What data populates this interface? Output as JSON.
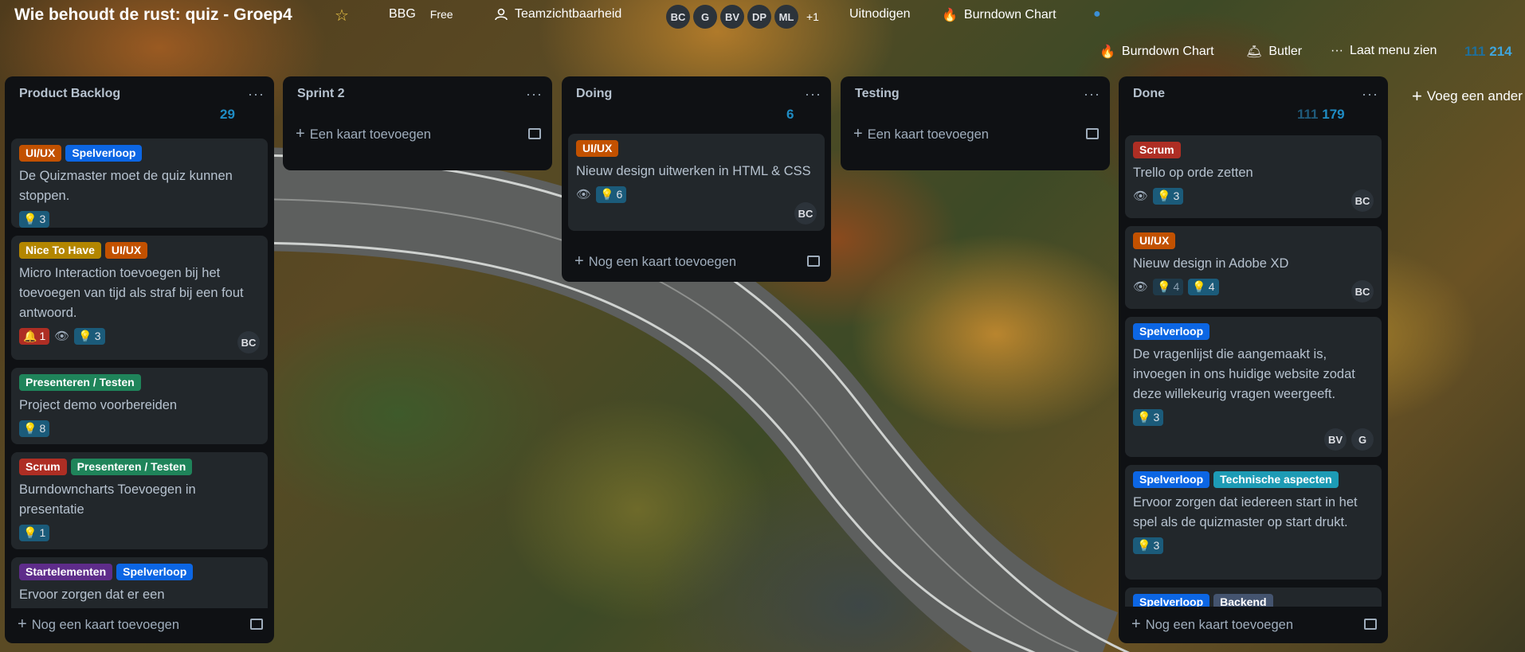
{
  "header": {
    "board_title": "Wie behoudt de rust: quiz - Groep4",
    "workspace": "BBG",
    "plan": "Free",
    "visibility": "Teamzichtbaarheid",
    "members": [
      "BC",
      "G",
      "BV",
      "DP",
      "ML"
    ],
    "more_members": "+1",
    "invite": "Uitnodigen",
    "burndown": "Burndown Chart",
    "burndown2": "Burndown Chart",
    "butler": "Butler",
    "show_menu": "Laat menu zien",
    "counter_muted": "111",
    "counter_bright": "214"
  },
  "add_list": "Voeg een ander",
  "lists": {
    "backlog": {
      "title": "Product Backlog",
      "count": "29",
      "add_label": "Nog een kaart toevoegen",
      "cards": [
        {
          "labels": [
            "UI/UX",
            "Spelverloop"
          ],
          "title": "De Quizmaster moet de quiz kunnen stoppen.",
          "lamp": "3"
        },
        {
          "labels": [
            "Nice To Have",
            "UI/UX"
          ],
          "title": "Micro Interaction toevoegen bij het toevoegen van tijd als straf bij een fout antwoord.",
          "alert": "1",
          "lamp": "3",
          "members": [
            "BC"
          ]
        },
        {
          "labels": [
            "Presenteren / Testen"
          ],
          "title": "Project demo voorbereiden",
          "lamp": "8"
        },
        {
          "labels": [
            "Scrum",
            "Presenteren / Testen"
          ],
          "title": "Burndowncharts Toevoegen in presentatie",
          "lamp": "1"
        },
        {
          "labels": [
            "Startelementen",
            "Spelverloop"
          ],
          "title": "Ervoor zorgen dat er een"
        }
      ]
    },
    "sprint2": {
      "title": "Sprint 2",
      "add_label": "Een kaart toevoegen"
    },
    "doing": {
      "title": "Doing",
      "count": "6",
      "add_label": "Nog een kaart toevoegen",
      "cards": [
        {
          "labels": [
            "UI/UX"
          ],
          "title": "Nieuw design uitwerken in HTML & CSS",
          "lamp": "6",
          "members": [
            "BC"
          ]
        }
      ]
    },
    "testing": {
      "title": "Testing",
      "add_label": "Een kaart toevoegen"
    },
    "done": {
      "title": "Done",
      "count_muted": "111",
      "count_bright": "179",
      "add_label": "Nog een kaart toevoegen",
      "cards": [
        {
          "labels": [
            "Scrum"
          ],
          "title": "Trello op orde zetten",
          "lamp": "3",
          "members": [
            "BC"
          ]
        },
        {
          "labels": [
            "UI/UX"
          ],
          "title": "Nieuw design in Adobe XD",
          "lamp_dim": "4",
          "lamp": "4",
          "members": [
            "BC"
          ]
        },
        {
          "labels": [
            "Spelverloop"
          ],
          "title": "De vragenlijst die aangemaakt is, invoegen in ons huidige website zodat deze willekeurig vragen weergeeft.",
          "lamp": "3",
          "members": [
            "BV",
            "G"
          ]
        },
        {
          "labels": [
            "Spelverloop",
            "Technische aspecten"
          ],
          "title": "Ervoor zorgen dat iedereen start in het spel als de quizmaster op start drukt.",
          "lamp": "3"
        },
        {
          "labels": [
            "Spelverloop",
            "Backend"
          ],
          "title": ""
        }
      ]
    }
  },
  "label_colors": {
    "UI/UX": "#c25100",
    "Spelverloop": "#0c66e4",
    "Nice To Have": "#b38600",
    "Presenteren / Testen": "#1f845a",
    "Scrum": "#ae2e24",
    "Startelementen": "#5e2c8a",
    "Technische aspecten": "#1d9bb5",
    "Backend": "#44546f"
  },
  "icons": [
    "star-icon",
    "people-icon",
    "flame-icon",
    "bell-icon",
    "eye-icon",
    "lamp-icon",
    "template-icon",
    "plus-icon",
    "more-icon"
  ]
}
